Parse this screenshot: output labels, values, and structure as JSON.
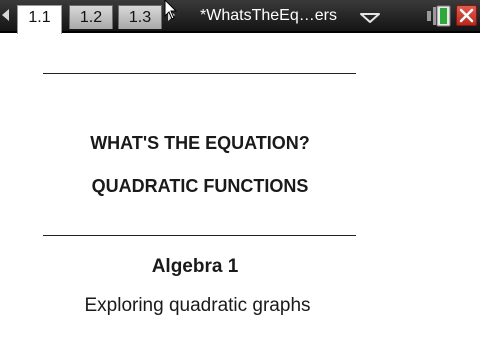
{
  "tabs": [
    {
      "label": "1.1",
      "active": true
    },
    {
      "label": "1.2",
      "active": false
    },
    {
      "label": "1.3",
      "active": false
    }
  ],
  "document": {
    "title": "*WhatsTheEq…ers"
  },
  "page": {
    "heading_line1": "WHAT'S THE EQUATION?",
    "heading_line2": "QUADRATIC FUNCTIONS",
    "subject": "Algebra 1",
    "subtitle": "Exploring quadratic graphs"
  },
  "icons": {
    "prev_page": "triangle-left-icon",
    "next_page": "triangle-right-icon",
    "document_menu": "chevron-down-icon",
    "battery": "battery-icon",
    "close": "close-icon",
    "cursor": "mouse-cursor-icon"
  },
  "colors": {
    "toolbar": "#1e1e1e",
    "close_button": "#d0453a",
    "battery_fill": "#2fa83a"
  }
}
